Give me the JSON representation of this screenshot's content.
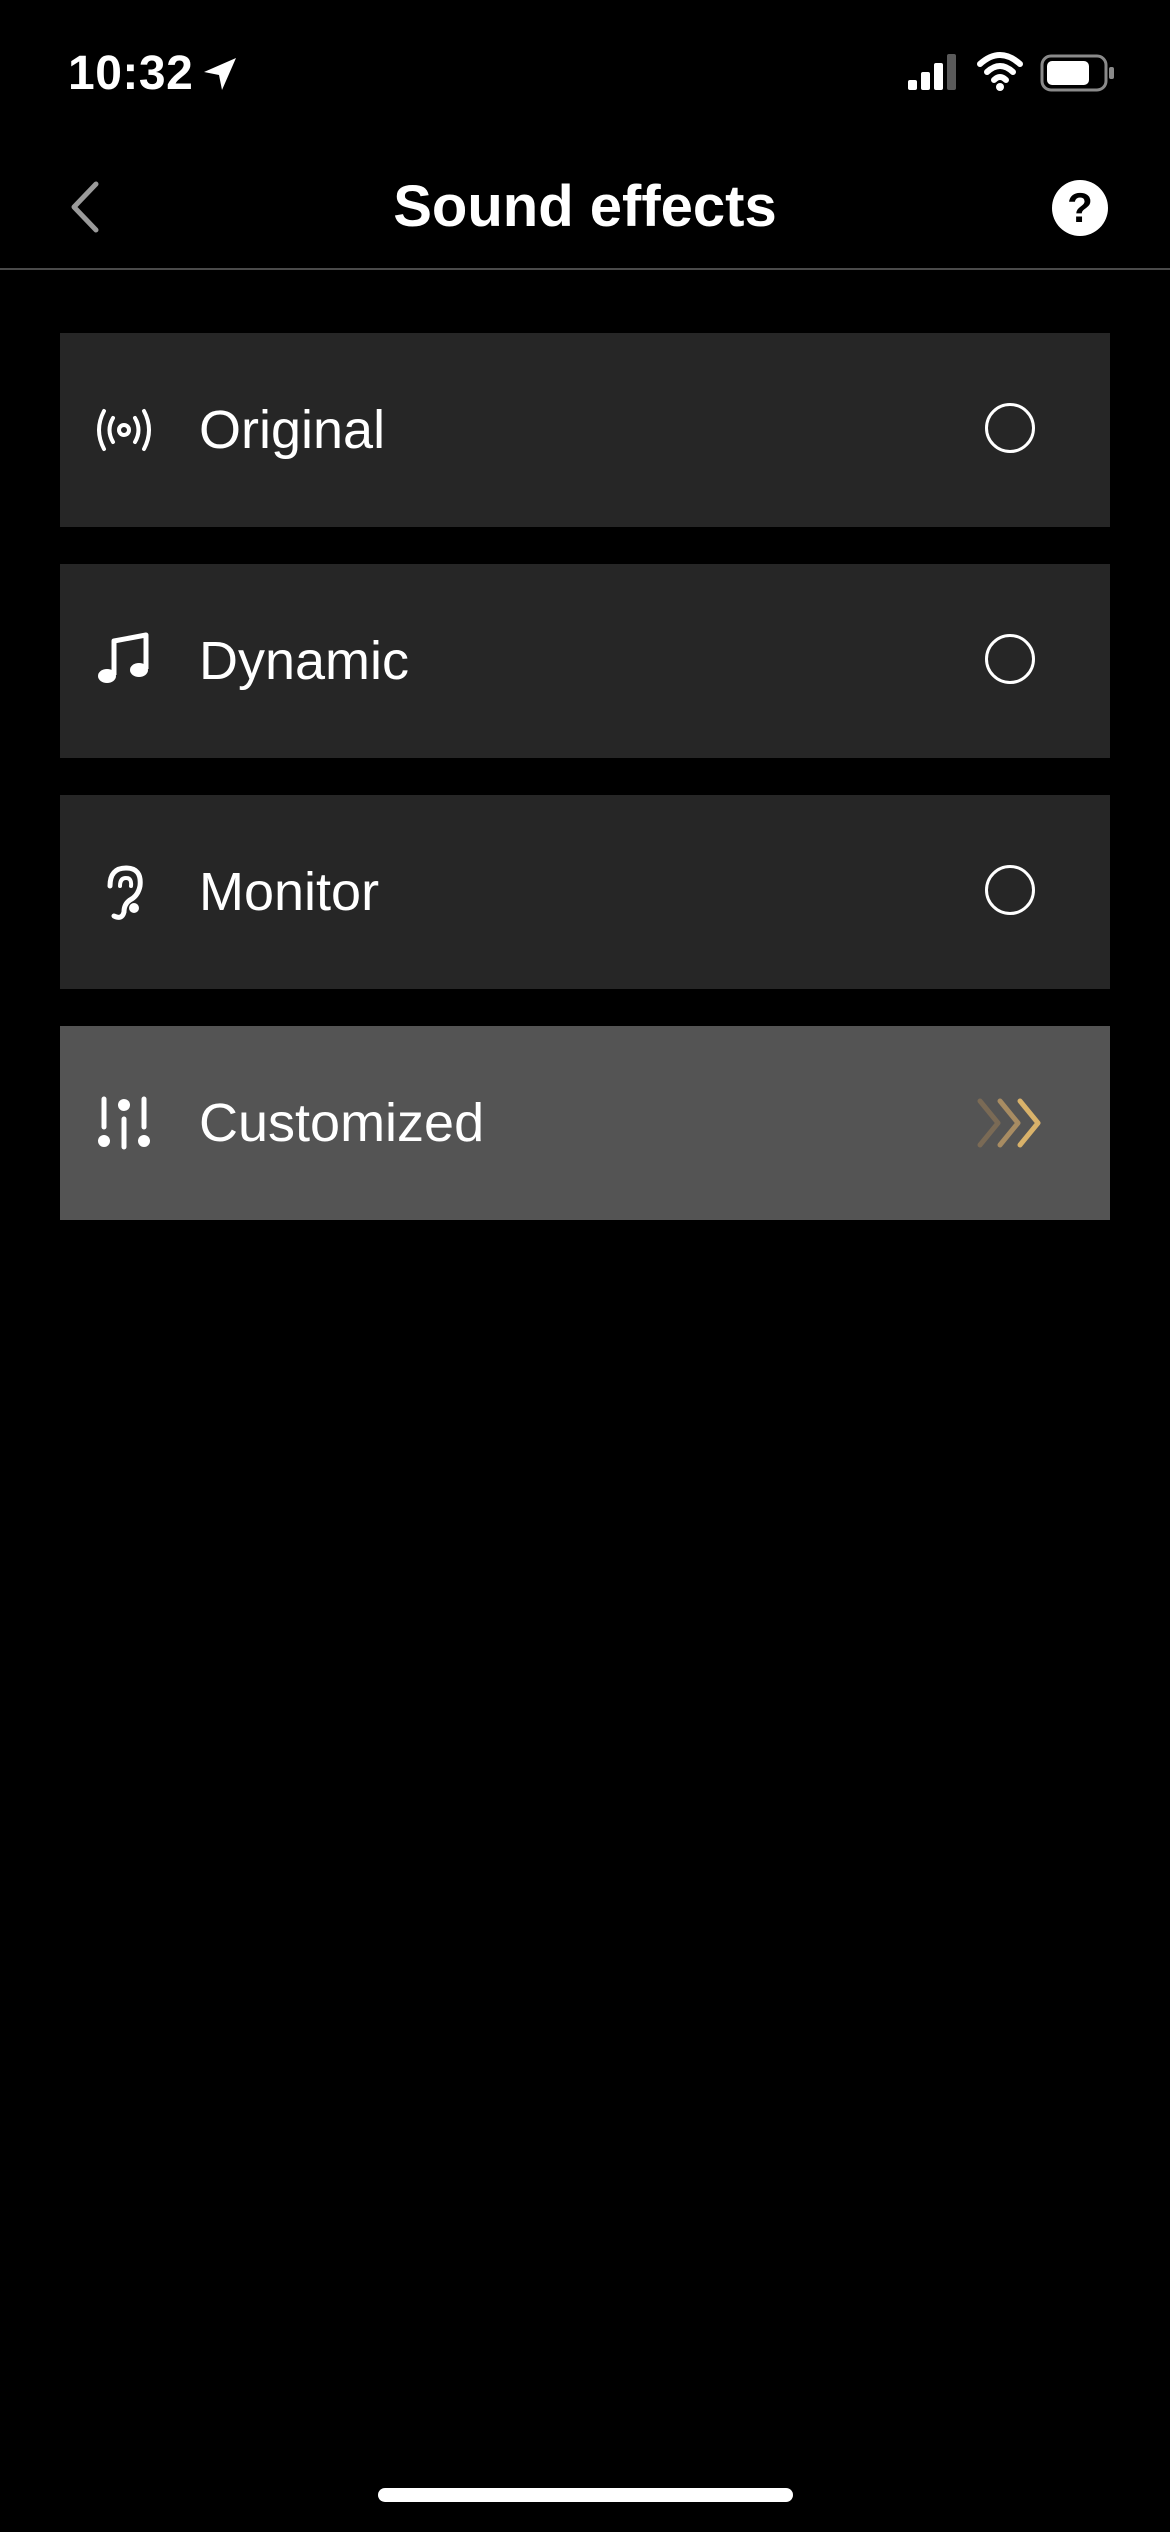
{
  "status_bar": {
    "time": "10:32"
  },
  "nav": {
    "title": "Sound effects",
    "help_label": "?"
  },
  "options": [
    {
      "label": "Original",
      "icon": "broadcast-icon",
      "selected": false
    },
    {
      "label": "Dynamic",
      "icon": "music-note-icon",
      "selected": false
    },
    {
      "label": "Monitor",
      "icon": "ear-icon",
      "selected": false
    },
    {
      "label": "Customized",
      "icon": "sliders-icon",
      "highlighted": true
    }
  ],
  "colors": {
    "background": "#000000",
    "row_background": "#262626",
    "row_highlight": "#545454",
    "accent_gold": "#d9b26a",
    "divider": "#4a4a4a"
  }
}
